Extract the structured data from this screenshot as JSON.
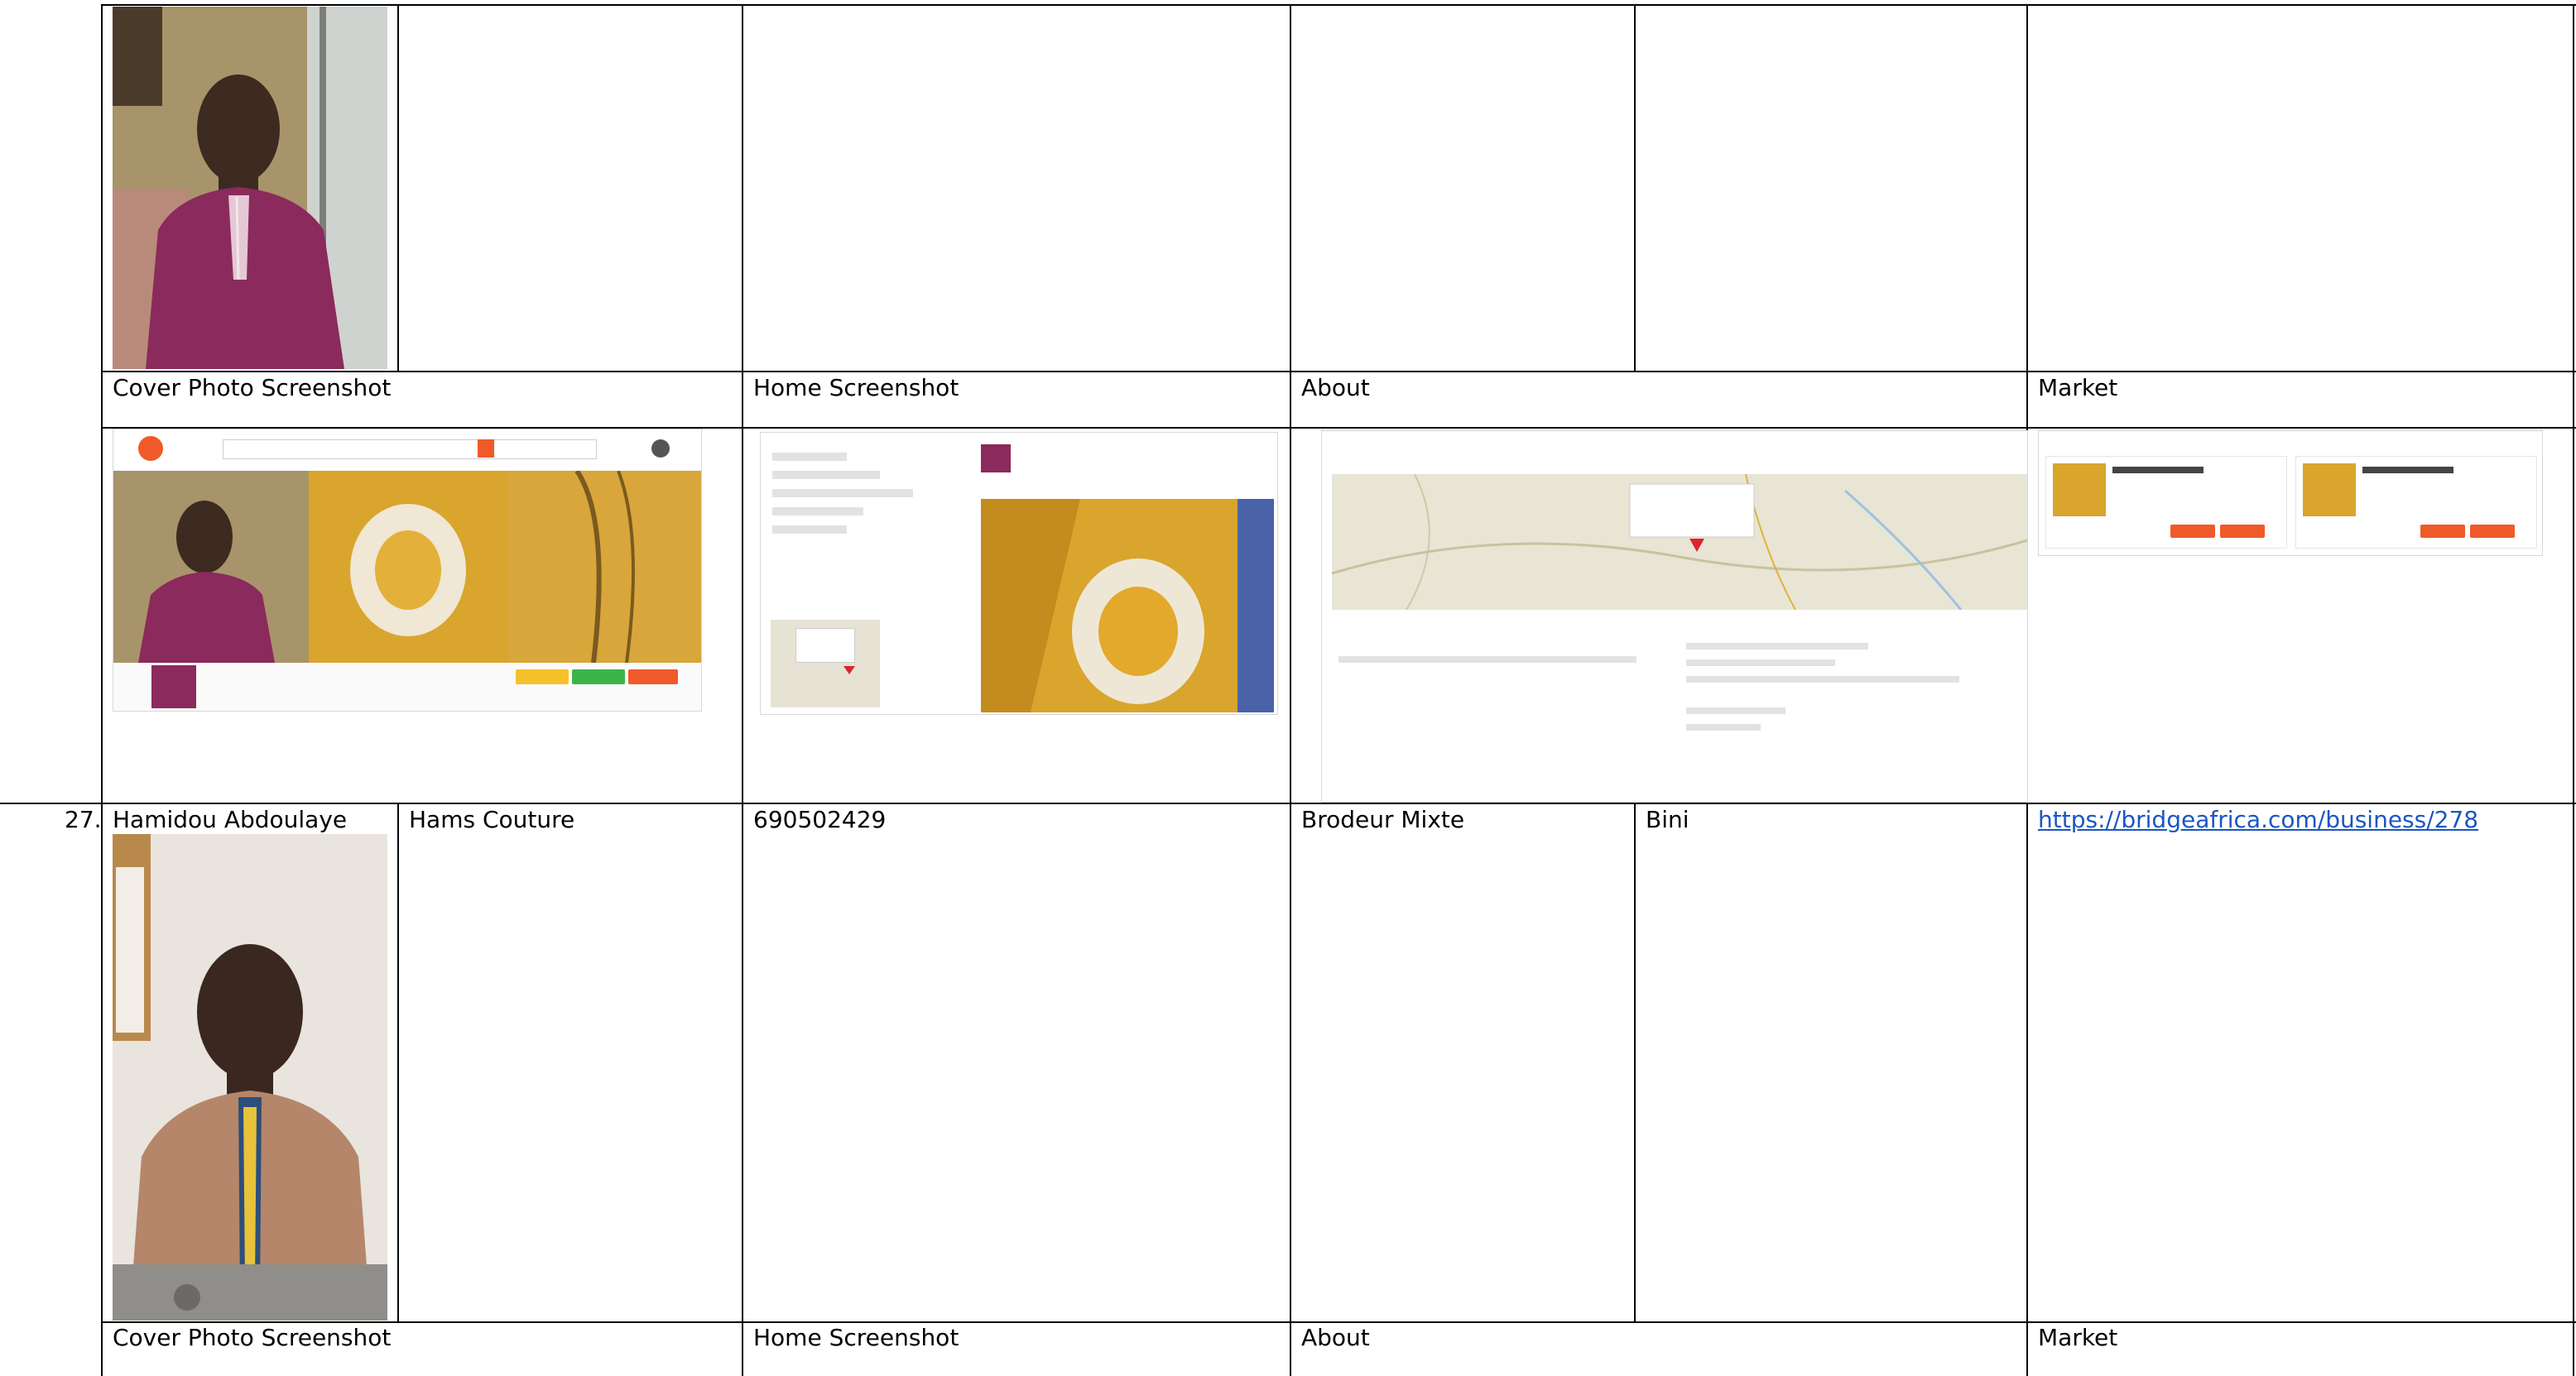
{
  "rows": [
    {
      "labels": {
        "cover": "Cover Photo Screenshot",
        "home": "Home Screenshot",
        "about": "About",
        "market": "Market"
      }
    },
    {
      "number": "27.",
      "name": "Hamidou Abdoulaye",
      "business": "Hams Couture",
      "phone": "690502429",
      "category": "Brodeur Mixte",
      "location": "Bini",
      "url": "https://bridgeafrica.com/business/278",
      "labels": {
        "cover": "Cover Photo Screenshot",
        "home": "Home Screenshot",
        "about": "About",
        "market": "Market"
      }
    }
  ],
  "colors": {
    "link": "#1a56c4",
    "accent_orange": "#f05a28",
    "accent_green": "#3bb54a",
    "accent_yellow": "#f5c02a",
    "map_red": "#d9262c"
  }
}
